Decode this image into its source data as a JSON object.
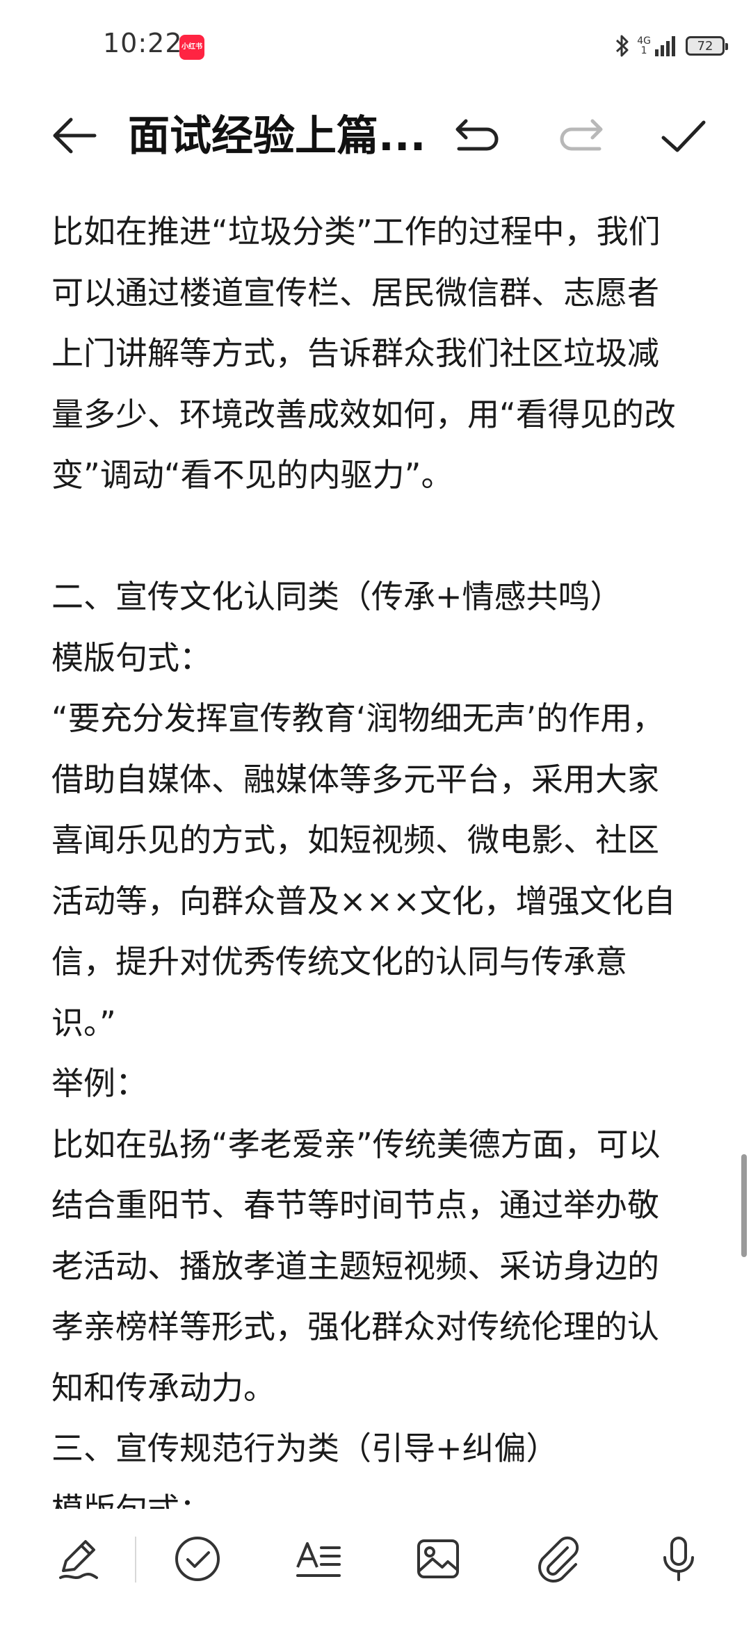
{
  "status_bar": {
    "time": "10:22",
    "app_badge": "小红书",
    "network": "4G",
    "network_sub": "1",
    "battery": "72"
  },
  "header": {
    "title": "面试经验上篇..."
  },
  "document": {
    "lines": [
      "比如在推进“垃圾分类”工作的过程中，我们",
      "可以通过楼道宣传栏、居民微信群、志愿者",
      "上门讲解等方式，告诉群众我们社区垃圾减",
      "量多少、环境改善成效如何，用“看得见的改",
      "变”调动“看不见的内驱力”。",
      "",
      "二、宣传文化认同类（传承+情感共鸣）",
      "模版句式：",
      "“要充分发挥宣传教育‘润物细无声’的作用，",
      "借助自媒体、融媒体等多元平台，采用大家",
      "喜闻乐见的方式，如短视频、微电影、社区",
      "活动等，向群众普及×××文化，增强文化自",
      "信，提升对优秀传统文化的认同与传承意",
      "识。”",
      "举例：",
      "比如在弘扬“孝老爱亲”传统美德方面，可以",
      "结合重阳节、春节等时间节点，通过举办敬",
      "老活动、播放孝道主题短视频、采访身边的",
      "孝亲榜样等形式，强化群众对传统伦理的认",
      "知和传承动力。",
      "三、宣传规范行为类（引导+纠偏）",
      "模版句式："
    ]
  },
  "toolbar": {
    "tools": [
      "pen-icon",
      "checklist-icon",
      "text-format-icon",
      "image-icon",
      "attachment-icon",
      "microphone-icon"
    ]
  }
}
